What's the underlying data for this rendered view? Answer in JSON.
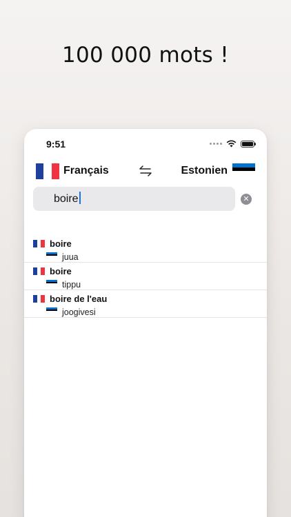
{
  "headline": "100 000 mots !",
  "status_bar": {
    "time": "9:51"
  },
  "languages": {
    "source": {
      "label": "Français",
      "flag": "france-flag"
    },
    "target": {
      "label": "Estonien",
      "flag": "estonia-flag"
    },
    "swap_icon": "swap-arrows-icon"
  },
  "search": {
    "value": "boire",
    "clear_icon": "clear-icon"
  },
  "results": [
    {
      "word": "boire",
      "translation": "juua"
    },
    {
      "word": "boire",
      "translation": "tippu"
    },
    {
      "word": "boire de l'eau",
      "translation": "joogivesi"
    }
  ],
  "colors": {
    "fr_blue": "#1f3f9d",
    "fr_white": "#ffffff",
    "fr_red": "#ef3340",
    "ee_blue": "#0072ce",
    "ee_black": "#000000",
    "ee_white": "#ffffff"
  }
}
